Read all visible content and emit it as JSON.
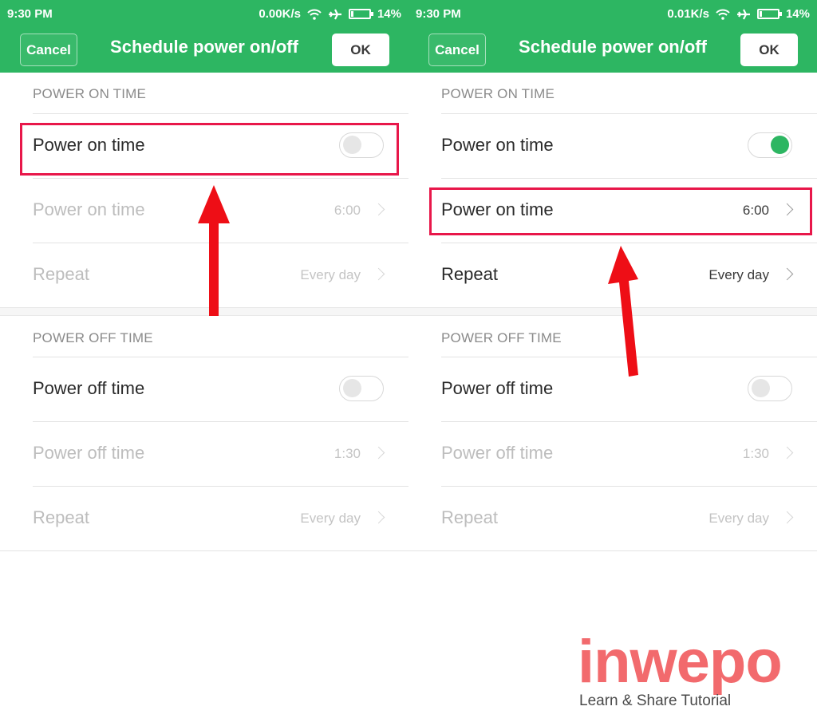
{
  "screens": [
    {
      "status": {
        "time": "9:30 PM",
        "speed": "0.00K/s",
        "battery": "14%"
      },
      "header": {
        "cancel_label": "Cancel",
        "title": "Schedule power on/off",
        "ok_label": "OK"
      },
      "power_on": {
        "section_label": "POWER ON TIME",
        "toggle_label": "Power on time",
        "toggle_on": false,
        "time_label": "Power on time",
        "time_value": "6:00",
        "repeat_label": "Repeat",
        "repeat_value": "Every day"
      },
      "power_off": {
        "section_label": "POWER OFF TIME",
        "toggle_label": "Power off time",
        "toggle_on": false,
        "time_label": "Power off time",
        "time_value": "1:30",
        "repeat_label": "Repeat",
        "repeat_value": "Every day"
      }
    },
    {
      "status": {
        "time": "9:30 PM",
        "speed": "0.01K/s",
        "battery": "14%"
      },
      "header": {
        "cancel_label": "Cancel",
        "title": "Schedule power on/off",
        "ok_label": "OK"
      },
      "power_on": {
        "section_label": "POWER ON TIME",
        "toggle_label": "Power on time",
        "toggle_on": true,
        "time_label": "Power on time",
        "time_value": "6:00",
        "repeat_label": "Repeat",
        "repeat_value": "Every day"
      },
      "power_off": {
        "section_label": "POWER OFF TIME",
        "toggle_label": "Power off time",
        "toggle_on": false,
        "time_label": "Power off time",
        "time_value": "1:30",
        "repeat_label": "Repeat",
        "repeat_value": "Every day"
      }
    }
  ],
  "watermark": {
    "brand": "inwepo",
    "tagline": "Learn & Share Tutorial"
  },
  "colors": {
    "accent": "#2db662",
    "highlight": "#e8174a",
    "arrow": "#ee0e16",
    "watermark": "#f26a6d"
  }
}
